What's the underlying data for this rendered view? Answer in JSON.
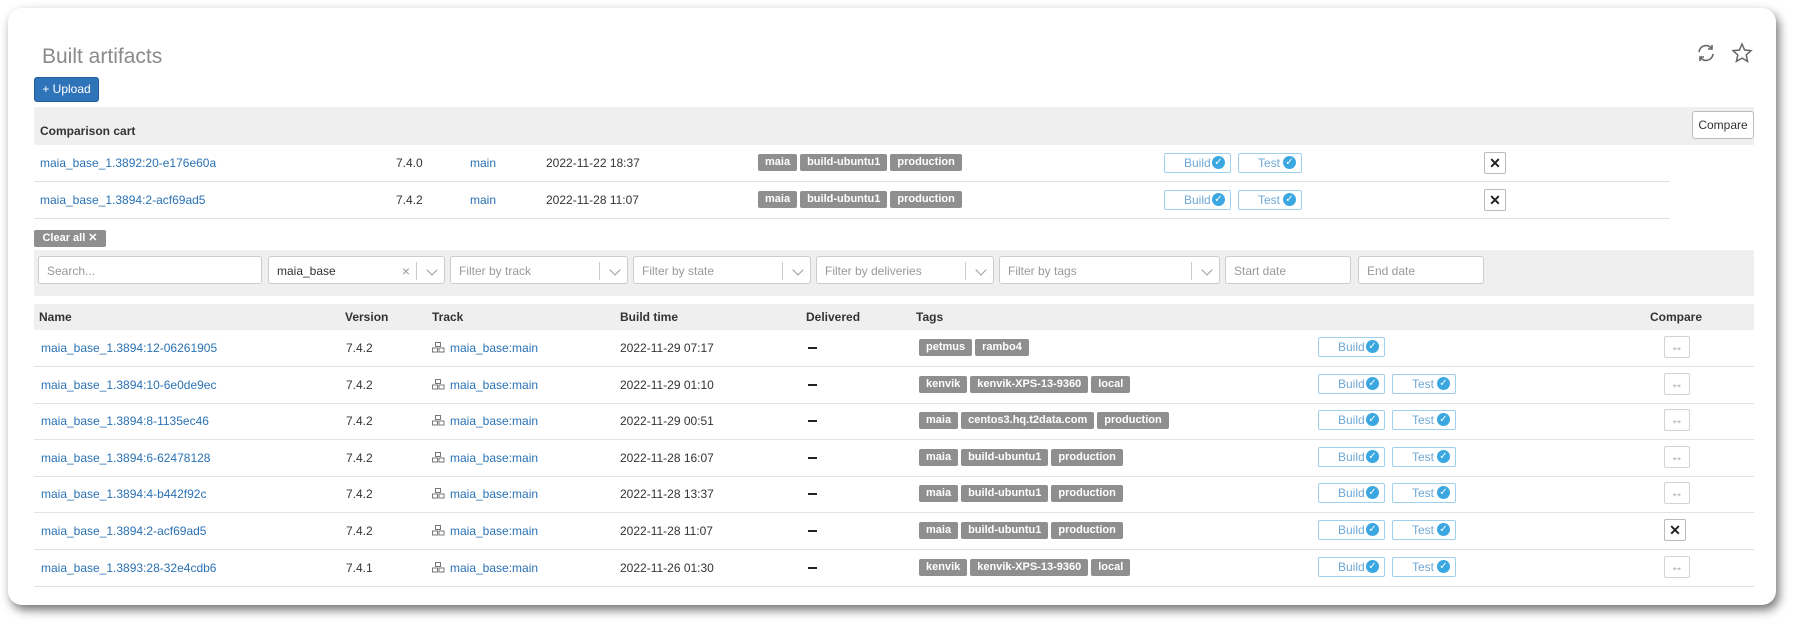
{
  "page": {
    "title": "Built artifacts"
  },
  "header_icons": [
    "refresh-icon",
    "star-icon"
  ],
  "upload_label": "+ Upload",
  "cart": {
    "title": "Comparison cart",
    "compare_label": "Compare",
    "rows": [
      {
        "name": "maia_base_1.3892:20-e176e60a",
        "version": "7.4.0",
        "track": "main",
        "time": "2022-11-22 18:37",
        "tags": [
          "maia",
          "build-ubuntu1",
          "production"
        ],
        "stages": [
          "Build",
          "Test"
        ]
      },
      {
        "name": "maia_base_1.3894:2-acf69ad5",
        "version": "7.4.2",
        "track": "main",
        "time": "2022-11-28 11:07",
        "tags": [
          "maia",
          "build-ubuntu1",
          "production"
        ],
        "stages": [
          "Build",
          "Test"
        ]
      }
    ]
  },
  "clear_all_label": "Clear all ✕",
  "filters": {
    "search_placeholder": "Search...",
    "name_value": "maia_base",
    "track_placeholder": "Filter by track",
    "state_placeholder": "Filter by state",
    "deliveries_placeholder": "Filter by deliveries",
    "tags_placeholder": "Filter by tags",
    "start_date_placeholder": "Start date",
    "end_date_placeholder": "End date"
  },
  "table": {
    "columns": {
      "name": "Name",
      "version": "Version",
      "track": "Track",
      "build_time": "Build time",
      "delivered": "Delivered",
      "tags": "Tags",
      "compare": "Compare"
    },
    "rows": [
      {
        "name": "maia_base_1.3894:12-06261905",
        "version": "7.4.2",
        "track": "maia_base:main",
        "time": "2022-11-29 07:17",
        "tags": [
          "petmus",
          "rambo4"
        ],
        "stages": [
          "Build"
        ],
        "in_cart": false
      },
      {
        "name": "maia_base_1.3894:10-6e0de9ec",
        "version": "7.4.2",
        "track": "maia_base:main",
        "time": "2022-11-29 01:10",
        "tags": [
          "kenvik",
          "kenvik-XPS-13-9360",
          "local"
        ],
        "stages": [
          "Build",
          "Test"
        ],
        "in_cart": false
      },
      {
        "name": "maia_base_1.3894:8-1135ec46",
        "version": "7.4.2",
        "track": "maia_base:main",
        "time": "2022-11-29 00:51",
        "tags": [
          "maia",
          "centos3.hq.t2data.com",
          "production"
        ],
        "stages": [
          "Build",
          "Test"
        ],
        "in_cart": false
      },
      {
        "name": "maia_base_1.3894:6-62478128",
        "version": "7.4.2",
        "track": "maia_base:main",
        "time": "2022-11-28 16:07",
        "tags": [
          "maia",
          "build-ubuntu1",
          "production"
        ],
        "stages": [
          "Build",
          "Test"
        ],
        "in_cart": false
      },
      {
        "name": "maia_base_1.3894:4-b442f92c",
        "version": "7.4.2",
        "track": "maia_base:main",
        "time": "2022-11-28 13:37",
        "tags": [
          "maia",
          "build-ubuntu1",
          "production"
        ],
        "stages": [
          "Build",
          "Test"
        ],
        "in_cart": false
      },
      {
        "name": "maia_base_1.3894:2-acf69ad5",
        "version": "7.4.2",
        "track": "maia_base:main",
        "time": "2022-11-28 11:07",
        "tags": [
          "maia",
          "build-ubuntu1",
          "production"
        ],
        "stages": [
          "Build",
          "Test"
        ],
        "in_cart": true
      },
      {
        "name": "maia_base_1.3893:28-32e4cdb6",
        "version": "7.4.1",
        "track": "maia_base:main",
        "time": "2022-11-26 01:30",
        "tags": [
          "kenvik",
          "kenvik-XPS-13-9360",
          "local"
        ],
        "stages": [
          "Build",
          "Test"
        ],
        "in_cart": false
      }
    ]
  },
  "colors": {
    "primary": "#2f73b8",
    "link": "#2a72b5",
    "tag": "#8f8f8f",
    "stage_border": "#9fd1ee",
    "stage_check": "#3ba7e0"
  }
}
